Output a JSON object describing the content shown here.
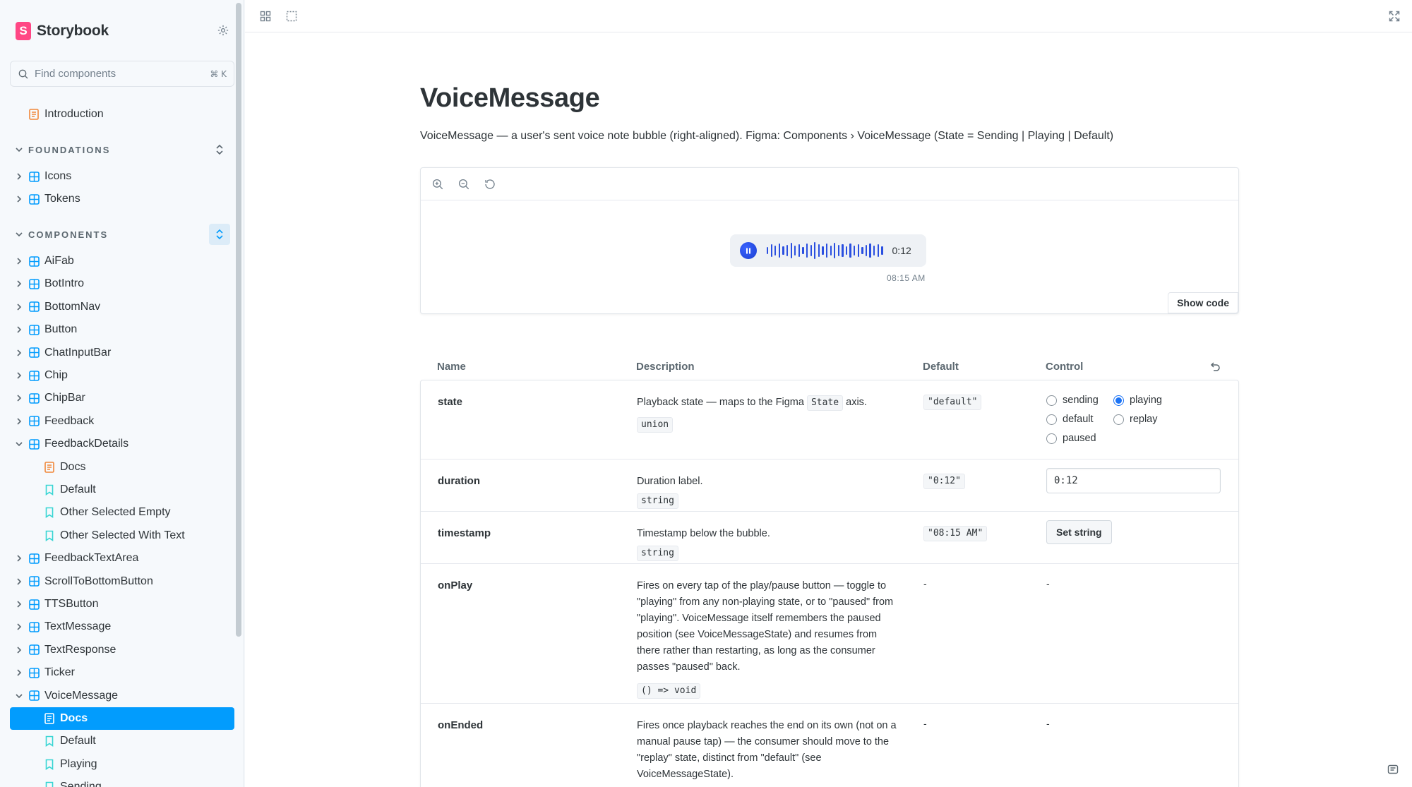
{
  "app": {
    "brand": "Storybook"
  },
  "search": {
    "placeholder": "Find components",
    "shortcut": "⌘ K"
  },
  "sidebar": {
    "introduction": "Introduction",
    "foundations_title": "FOUNDATIONS",
    "foundations": [
      "Icons",
      "Tokens"
    ],
    "components_title": "COMPONENTS",
    "components": [
      "AiFab",
      "BotIntro",
      "BottomNav",
      "Button",
      "ChatInputBar",
      "Chip",
      "ChipBar",
      "Feedback"
    ],
    "feedback_details": {
      "label": "FeedbackDetails",
      "children": [
        "Docs",
        "Default",
        "Other Selected Empty",
        "Other Selected With Text"
      ]
    },
    "components_more": [
      "FeedbackTextArea",
      "ScrollToBottomButton",
      "TTSButton",
      "TextMessage",
      "TextResponse",
      "Ticker"
    ],
    "voice_message": {
      "label": "VoiceMessage",
      "children": [
        "Docs",
        "Default",
        "Playing",
        "Sending"
      ]
    }
  },
  "doc": {
    "title": "VoiceMessage",
    "description": "VoiceMessage — a user's sent voice note bubble (right-aligned). Figma: Components › VoiceMessage (State = Sending | Playing | Default)"
  },
  "preview": {
    "duration": "0:12",
    "timestamp": "08:15 AM",
    "show_code": "Show code",
    "accent_color": "#2a4fe0"
  },
  "args_table": {
    "headers": {
      "name": "Name",
      "description": "Description",
      "default": "Default",
      "control": "Control"
    },
    "rows": {
      "state": {
        "name": "state",
        "desc_before": "Playback state — maps to the Figma",
        "desc_code": "State",
        "desc_after": "axis.",
        "type": "union",
        "default": "\"default\"",
        "options": [
          "sending",
          "playing",
          "default",
          "replay",
          "paused"
        ],
        "selected": "playing"
      },
      "duration": {
        "name": "duration",
        "desc": "Duration label.",
        "type": "string",
        "default": "\"0:12\"",
        "value": "0:12"
      },
      "timestamp": {
        "name": "timestamp",
        "desc": "Timestamp below the bubble.",
        "type": "string",
        "default": "\"08:15 AM\"",
        "control_label": "Set string"
      },
      "onPlay": {
        "name": "onPlay",
        "desc": "Fires on every tap of the play/pause button — toggle to \"playing\" from any non-playing state, or to \"paused\" from \"playing\". VoiceMessage itself remembers the paused position (see VoiceMessageState) and resumes from there rather than restarting, as long as the consumer passes \"paused\" back.",
        "type": "() => void",
        "default": "-",
        "control": "-"
      },
      "onEnded": {
        "name": "onEnded",
        "desc": "Fires once playback reaches the end on its own (not on a manual pause tap) — the consumer should move to the \"replay\" state, distinct from \"default\" (see VoiceMessageState).",
        "default": "-",
        "control": "-"
      }
    }
  },
  "colors": {
    "selected": "#029cfd",
    "brand": "#ff4785"
  }
}
